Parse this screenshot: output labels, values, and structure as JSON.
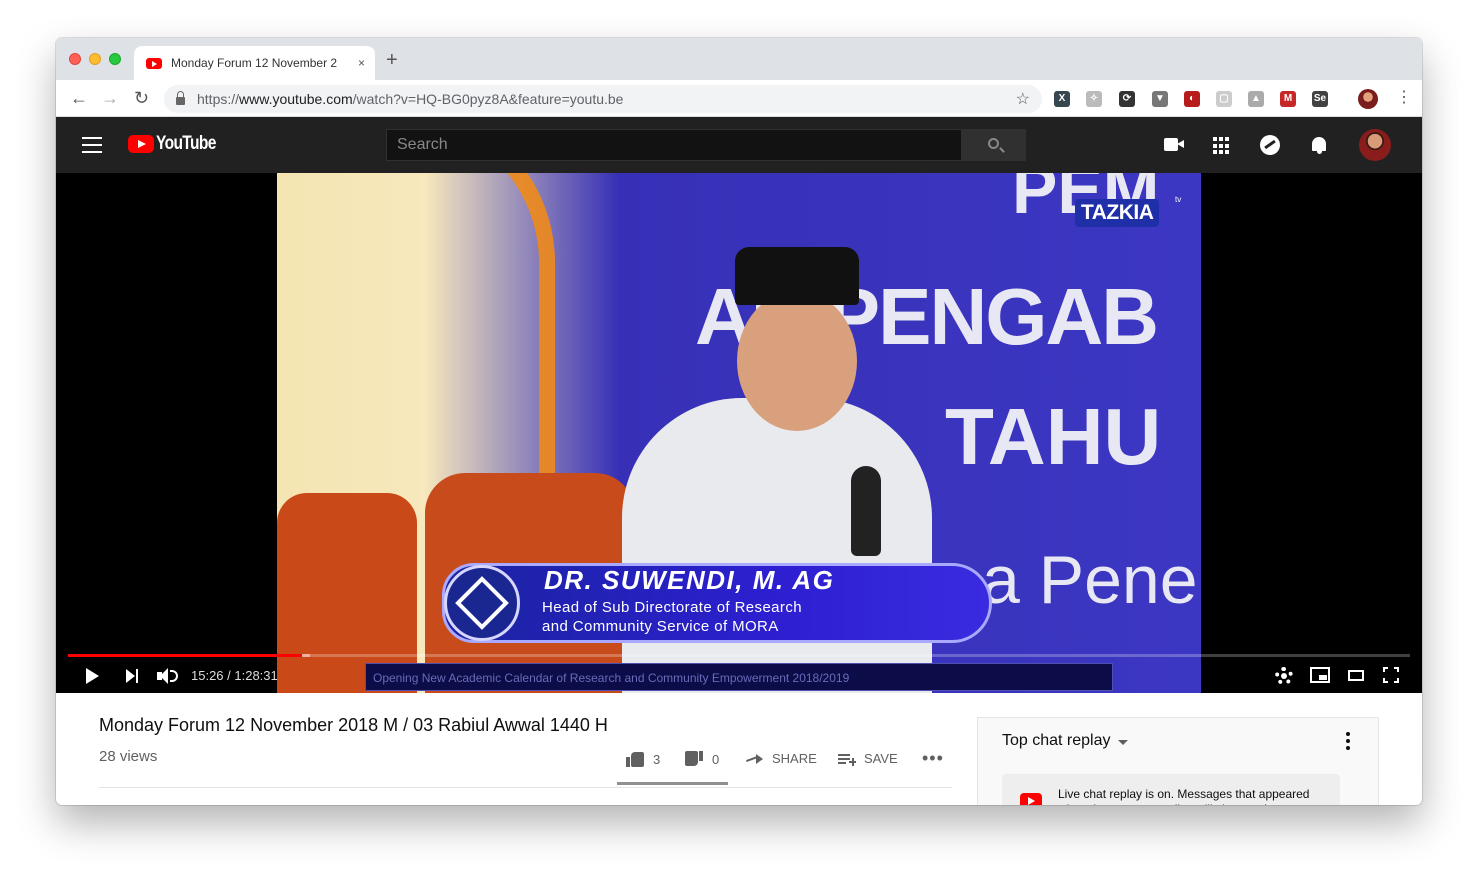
{
  "browser": {
    "tab_title": "Monday Forum 12 November 2",
    "tab_close": "×",
    "new_tab": "+",
    "back": "←",
    "forward": "→",
    "reload": "↻",
    "url_prefix": "https://",
    "url_domain": "www.youtube.com",
    "url_path": "/watch?v=HQ-BG0pyz8A&feature=youtu.be",
    "bookmark_star": "☆",
    "menu": "⋮",
    "extensions": [
      {
        "name": "ext-x",
        "label": "X",
        "color": "#37474f"
      },
      {
        "name": "ext-feather",
        "label": "✧",
        "color": "#bbbbbb"
      },
      {
        "name": "ext-sync",
        "label": "⟳",
        "color": "#333333"
      },
      {
        "name": "ext-vuejs",
        "label": "▼",
        "color": "#777777"
      },
      {
        "name": "ext-incognito",
        "label": "◐",
        "color": "#b71c1c"
      },
      {
        "name": "ext-chat",
        "label": "▢",
        "color": "#cccccc"
      },
      {
        "name": "ext-drive",
        "label": "▲",
        "color": "#aaaaaa"
      },
      {
        "name": "ext-m",
        "label": "M",
        "color": "#c62828"
      },
      {
        "name": "ext-se",
        "label": "Se",
        "color": "#424242"
      }
    ]
  },
  "youtube": {
    "logo_text": "YouTube",
    "search_placeholder": "Search"
  },
  "player": {
    "overlay": {
      "channel_logo": "TAZKIA",
      "channel_logo_suffix": "tv",
      "speaker_name": "DR. SUWENDI, M. AG",
      "speaker_role_line1": "Head of Sub Directorate of Research",
      "speaker_role_line2": "and Community Service of MORA",
      "ticker": "Opening New Academic Calendar of Research and Community Empowerment 2018/2019",
      "banner_line1": "PEM",
      "banner_line2": "AN PENGAB",
      "banner_line3": "TAHU",
      "banner_line4": "a Pene"
    },
    "current_time": "15:26",
    "duration": "1:28:31",
    "time_display": "15:26 / 1:28:31",
    "progress_fraction": 0.174,
    "buffered_fraction": 0.18
  },
  "video": {
    "title": "Monday Forum 12 November 2018 M / 03 Rabiul Awwal 1440 H",
    "views": "28 views",
    "likes": "3",
    "dislikes": "0",
    "share_label": "SHARE",
    "save_label": "SAVE",
    "more": "•••"
  },
  "chat": {
    "header": "Top chat replay",
    "notice": "Live chat replay is on. Messages that appeared when the stream was live will show up here."
  },
  "colors": {
    "yt_red": "#ff0000",
    "yt_dark": "#212121"
  }
}
